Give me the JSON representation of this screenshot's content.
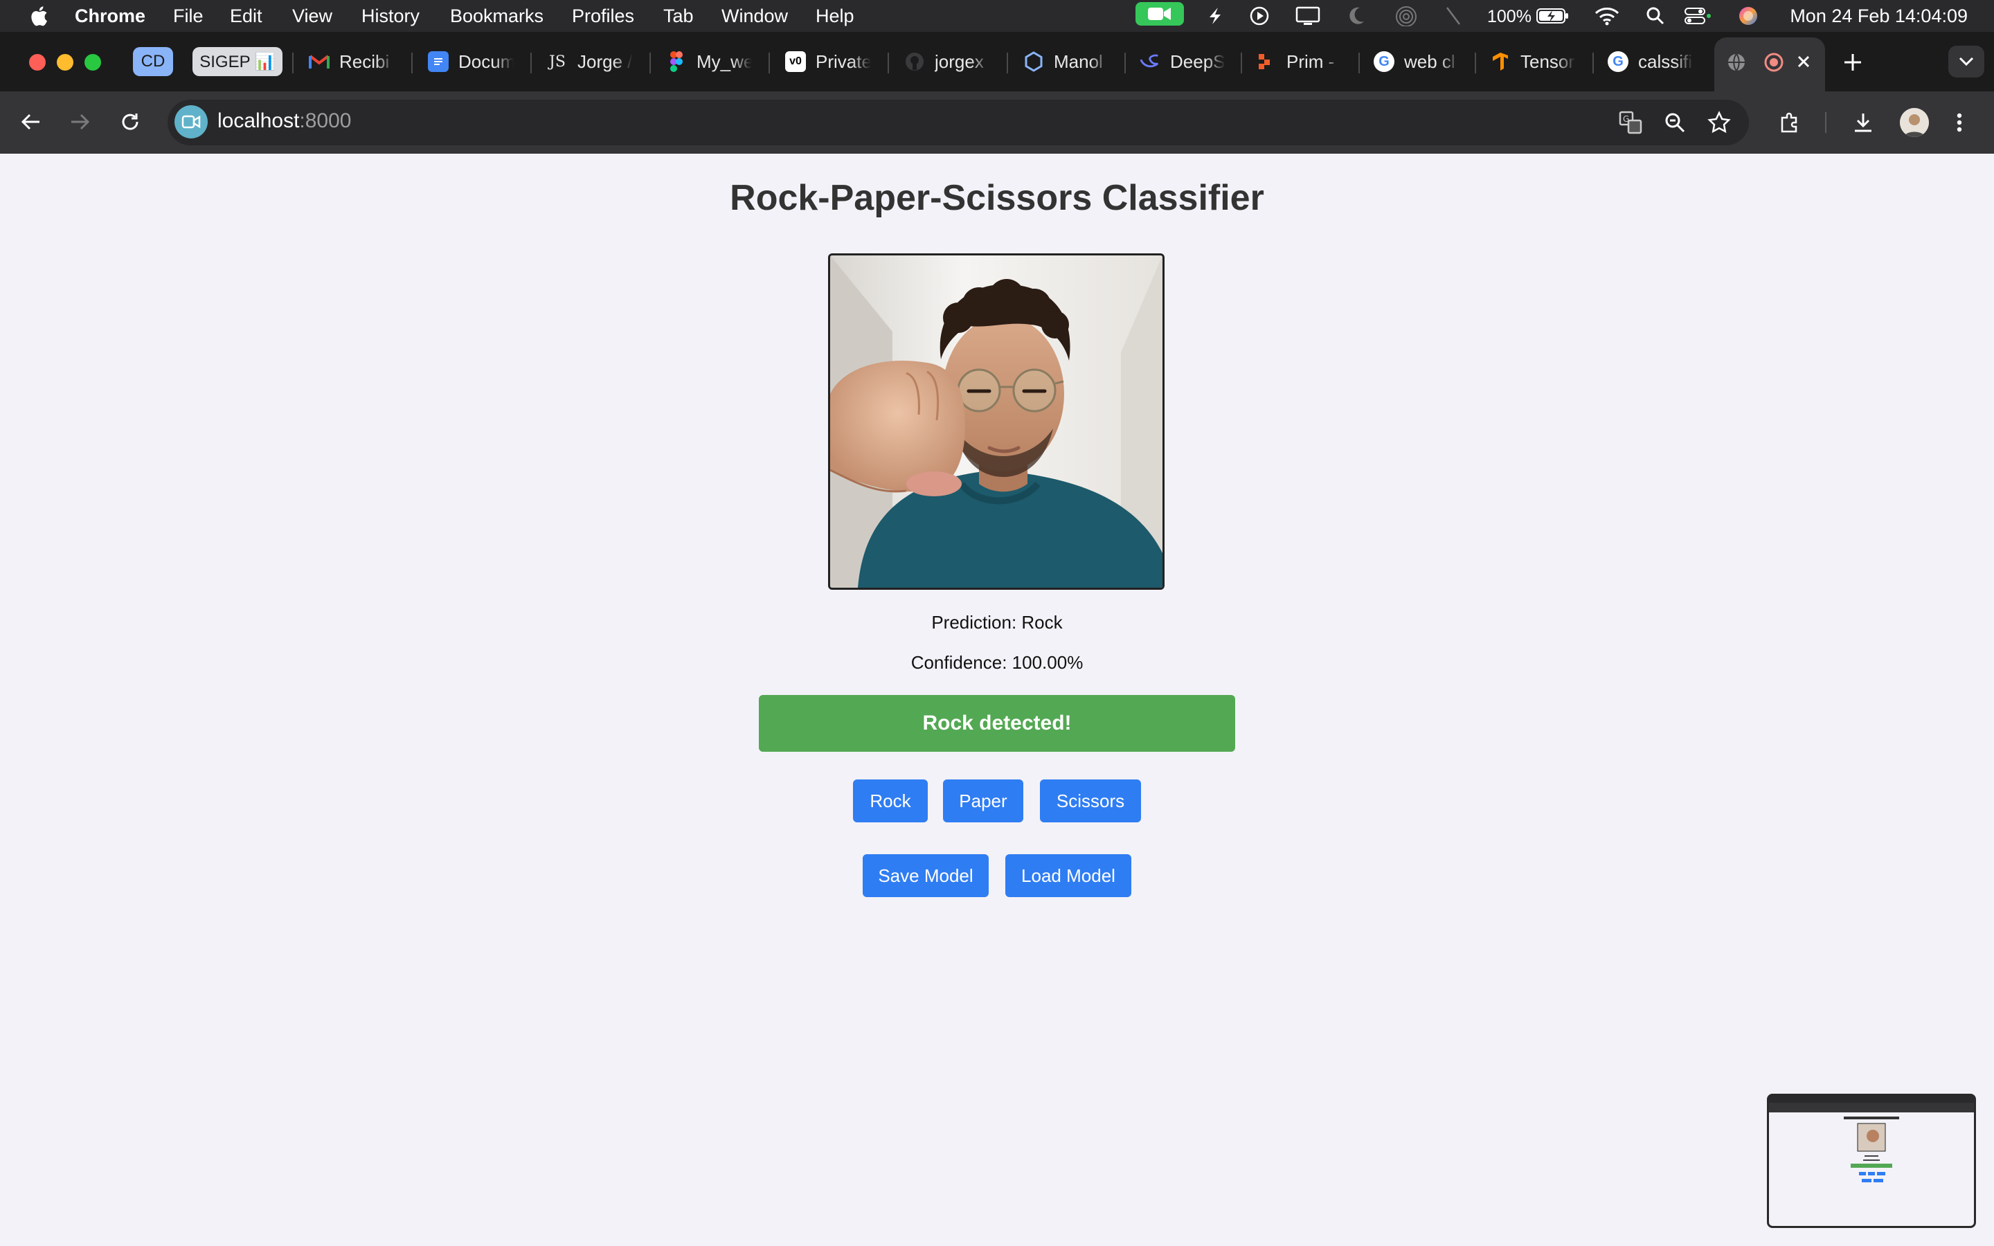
{
  "menubar": {
    "app_name": "Chrome",
    "menus": [
      "File",
      "Edit",
      "View",
      "History",
      "Bookmarks",
      "Profiles",
      "Tab",
      "Window",
      "Help"
    ],
    "battery": "100%",
    "clock": "Mon 24 Feb  14:04:09",
    "icons": [
      "apple-icon",
      "facetime-icon",
      "spark-icon",
      "play-circle-icon",
      "display-icon",
      "moon-icon",
      "airdrop-icon",
      "pen-slash-icon",
      "battery-icon",
      "wifi-icon",
      "search-icon",
      "control-center-icon",
      "siri-icon"
    ]
  },
  "tabs": {
    "groups": [
      {
        "label": "CD",
        "color": "#8ab4f8"
      },
      {
        "label": "SIGEP 📊",
        "color": "#dadce0"
      }
    ],
    "items": [
      {
        "label": "Recibi",
        "icon": "gmail-icon"
      },
      {
        "label": "Docum",
        "icon": "docs-icon"
      },
      {
        "label": "Jorge /",
        "icon": "js-icon"
      },
      {
        "label": "My_we",
        "icon": "figma-icon"
      },
      {
        "label": "Private",
        "icon": "vercel-icon"
      },
      {
        "label": "jorgex",
        "icon": "github-icon"
      },
      {
        "label": "Manol",
        "icon": "hexagon-icon"
      },
      {
        "label": "DeepS",
        "icon": "deepseek-icon"
      },
      {
        "label": "Prim -",
        "icon": "prim-icon"
      },
      {
        "label": "web cl",
        "icon": "google-icon"
      },
      {
        "label": "Tensor",
        "icon": "tensorflow-icon"
      },
      {
        "label": "calssifi",
        "icon": "google-icon"
      }
    ]
  },
  "toolbar": {
    "url_host": "localhost",
    "url_port": ":8000"
  },
  "page": {
    "title": "Rock-Paper-Scissors Classifier",
    "prediction": "Prediction: Rock",
    "confidence": "Confidence: 100.00%",
    "banner": "Rock detected!",
    "class_buttons": [
      "Rock",
      "Paper",
      "Scissors"
    ],
    "model_buttons": [
      "Save Model",
      "Load Model"
    ]
  },
  "colors": {
    "accent_button": "#2f7df2",
    "success_banner": "#53a853",
    "facetime_green": "#35c759"
  }
}
